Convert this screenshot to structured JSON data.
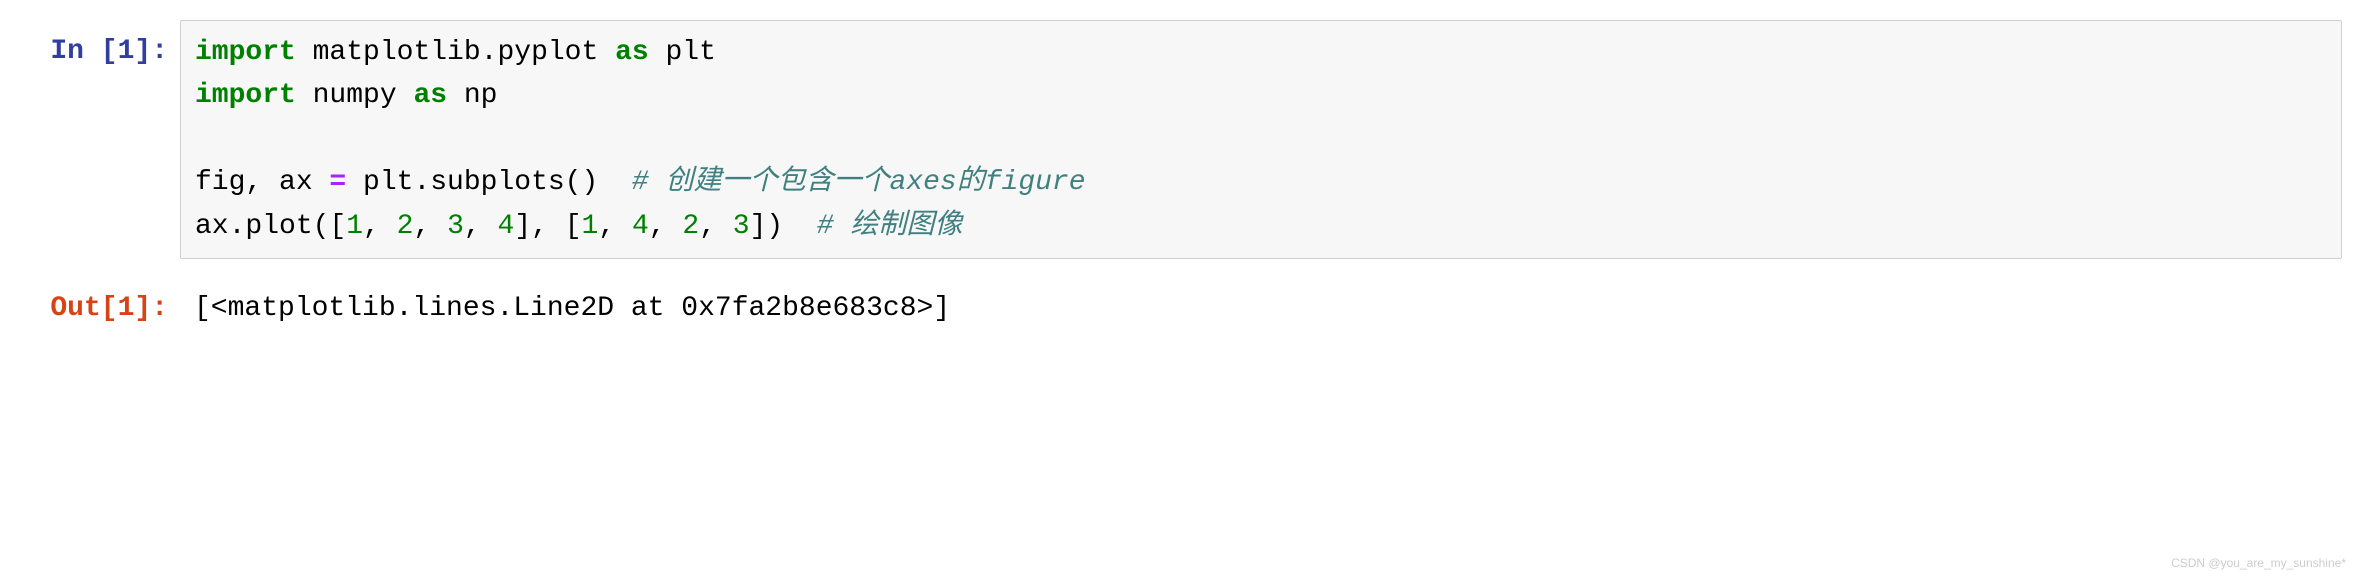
{
  "cells": {
    "input": {
      "prompt": "In [1]:",
      "code": {
        "line1_kw1": "import",
        "line1_txt1": " matplotlib.pyplot ",
        "line1_kw2": "as",
        "line1_txt2": " plt",
        "line2_kw1": "import",
        "line2_txt1": " numpy ",
        "line2_kw2": "as",
        "line2_txt2": " np",
        "line3": "",
        "line4_txt1": "fig, ax ",
        "line4_op": "=",
        "line4_txt2": " plt.subplots()  ",
        "line4_comment": "# 创建一个包含一个axes的figure",
        "line5_txt1": "ax.plot([",
        "line5_n1": "1",
        "line5_c1": ", ",
        "line5_n2": "2",
        "line5_c2": ", ",
        "line5_n3": "3",
        "line5_c3": ", ",
        "line5_n4": "4",
        "line5_txt2": "], [",
        "line5_n5": "1",
        "line5_c5": ", ",
        "line5_n6": "4",
        "line5_c6": ", ",
        "line5_n7": "2",
        "line5_c7": ", ",
        "line5_n8": "3",
        "line5_txt3": "])  ",
        "line5_comment": "# 绘制图像"
      }
    },
    "output": {
      "prompt": "Out[1]:",
      "text": "[<matplotlib.lines.Line2D at 0x7fa2b8e683c8>]"
    }
  },
  "watermark": "CSDN @you_are_my_sunshine*"
}
